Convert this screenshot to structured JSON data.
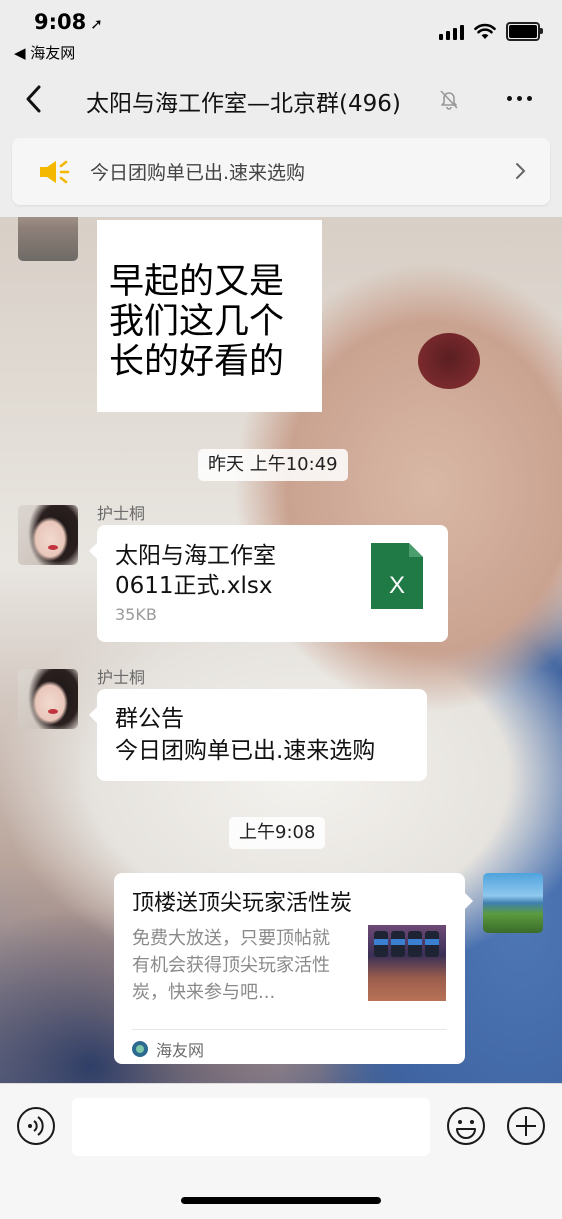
{
  "status_bar": {
    "time": "9:08",
    "back_app": "◀ 海友网"
  },
  "header": {
    "title": "太阳与海工作室—北京群(496)"
  },
  "pinned_notice": {
    "text": "今日团购单已出.速来选购"
  },
  "messages": {
    "sticker": {
      "text": "早起的又是\n我们这几个\n长的好看的"
    },
    "timestamp_1": "昨天 上午10:49",
    "file": {
      "sender": "护士桐",
      "name": "太阳与海工作室\n0611正式.xlsx",
      "size": "35KB",
      "icon_letter": "X"
    },
    "announcement": {
      "sender": "护士桐",
      "text": "群公告\n今日团购单已出.速来选购"
    },
    "timestamp_2": "上午9:08",
    "link": {
      "title": "顶楼送顶尖玩家活性炭",
      "description": "免费大放送，只要顶帖就有机会获得顶尖玩家活性炭，快来参与吧...",
      "source": "海友网"
    }
  },
  "input_bar": {
    "value": ""
  },
  "colors": {
    "excel_green": "#1f7a45",
    "notice_yellow": "#f5b800",
    "bubble_white": "#ffffff"
  },
  "icons": {
    "back": "chevron-left-icon",
    "mute": "bell-slash-icon",
    "more": "ellipsis-icon",
    "speaker": "speaker-icon",
    "voice": "voice-icon",
    "emoji": "emoji-icon",
    "plus": "plus-icon"
  }
}
